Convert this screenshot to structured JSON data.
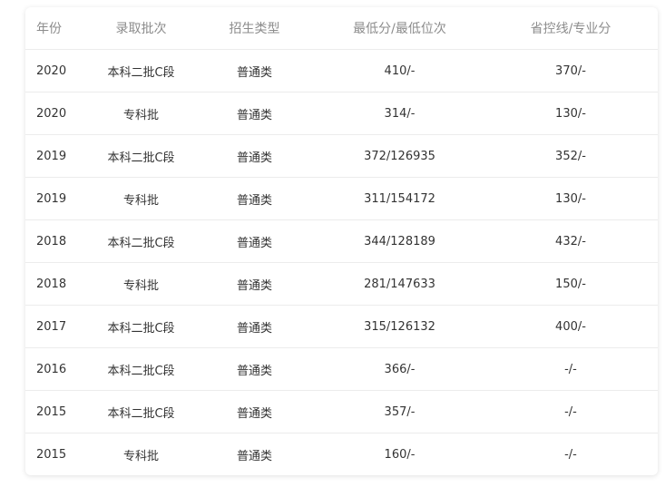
{
  "table": {
    "headers": {
      "year": "年份",
      "batch": "录取批次",
      "type": "招生类型",
      "score": "最低分/最低位次",
      "line": "省控线/专业分"
    },
    "rows": [
      {
        "year": "2020",
        "batch": "本科二批C段",
        "type": "普通类",
        "score": "410/-",
        "line": "370/-"
      },
      {
        "year": "2020",
        "batch": "专科批",
        "type": "普通类",
        "score": "314/-",
        "line": "130/-"
      },
      {
        "year": "2019",
        "batch": "本科二批C段",
        "type": "普通类",
        "score": "372/126935",
        "line": "352/-"
      },
      {
        "year": "2019",
        "batch": "专科批",
        "type": "普通类",
        "score": "311/154172",
        "line": "130/-"
      },
      {
        "year": "2018",
        "batch": "本科二批C段",
        "type": "普通类",
        "score": "344/128189",
        "line": "432/-"
      },
      {
        "year": "2018",
        "batch": "专科批",
        "type": "普通类",
        "score": "281/147633",
        "line": "150/-"
      },
      {
        "year": "2017",
        "batch": "本科二批C段",
        "type": "普通类",
        "score": "315/126132",
        "line": "400/-"
      },
      {
        "year": "2016",
        "batch": "本科二批C段",
        "type": "普通类",
        "score": "366/-",
        "line": "-/-"
      },
      {
        "year": "2015",
        "batch": "本科二批C段",
        "type": "普通类",
        "score": "357/-",
        "line": "-/-"
      },
      {
        "year": "2015",
        "batch": "专科批",
        "type": "普通类",
        "score": "160/-",
        "line": "-/-"
      }
    ]
  },
  "colors": {
    "header_text": "#8c8c8c",
    "cell_text": "#333333",
    "divider": "#ececec",
    "background": "#ffffff"
  }
}
